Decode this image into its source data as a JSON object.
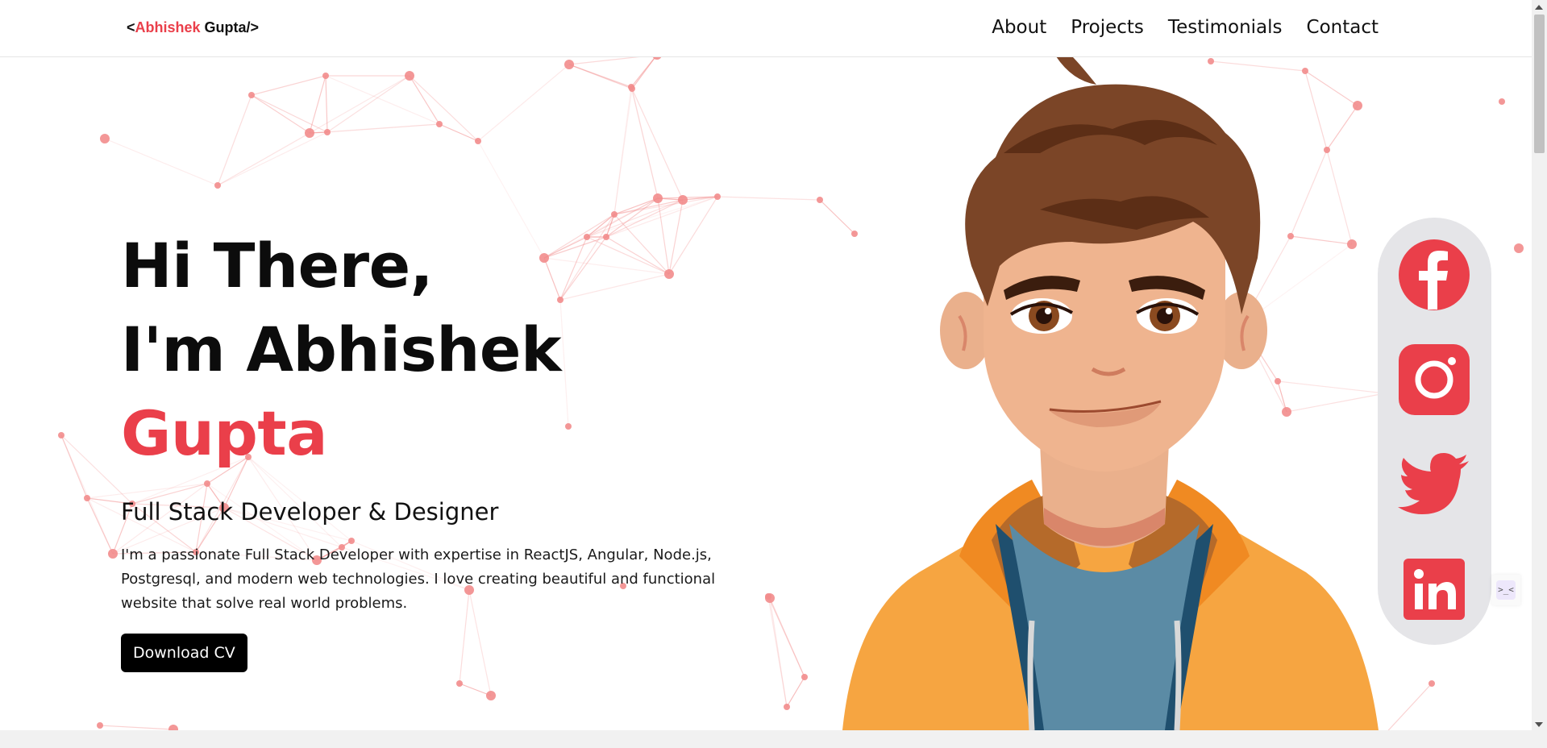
{
  "nav": {
    "logo_open": "<",
    "logo_first": "Abhishek",
    "logo_last": " Gupta/>",
    "links": [
      "About",
      "Projects",
      "Testimonials",
      "Contact"
    ]
  },
  "hero": {
    "greeting": "Hi There,",
    "intro": "I'm Abhishek ",
    "accent_name": "Gupta",
    "role": "Full Stack Developer & Designer",
    "bio": "I'm a passionate Full Stack Developer with expertise in ReactJS, Angular, Node.js, Postgresql, and modern web technologies. I love creating beautiful and functional website that solve real world problems.",
    "cta": "Download CV"
  },
  "social": [
    {
      "icon": "facebook-icon"
    },
    {
      "icon": "instagram-icon"
    },
    {
      "icon": "twitter-icon"
    },
    {
      "icon": "linkedin-icon"
    }
  ],
  "colors": {
    "accent": "#ea3f4a",
    "text": "#0c0c0c",
    "rail": "#e5e5e8",
    "network": "#f28c8c"
  }
}
